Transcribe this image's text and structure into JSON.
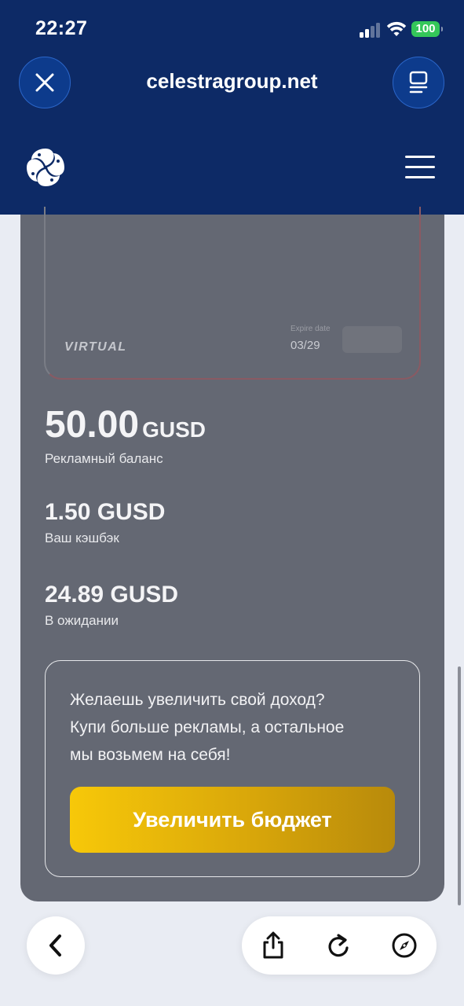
{
  "status_bar": {
    "time": "22:27",
    "battery": "100",
    "battery_color": "#34c759"
  },
  "browser": {
    "url": "celestragroup.net",
    "close_icon": "close-icon",
    "tabs_icon": "tabs-icon"
  },
  "site": {
    "logo": "celestra-logo",
    "menu_icon": "hamburger-menu-icon",
    "header_color": "#0d2a66"
  },
  "card": {
    "type_label": "VIRTUAL",
    "expire_label": "Expire date",
    "expire_value": "03/29"
  },
  "balances": {
    "ad_balance": {
      "amount": "50.00",
      "unit": "GUSD",
      "label": "Рекламный баланс"
    },
    "cashback": {
      "amount": "1.50 GUSD",
      "label": "Ваш кэшбэк"
    },
    "pending": {
      "amount": "24.89 GUSD",
      "label": "В ожидании"
    }
  },
  "promo": {
    "line1": "Желаешь увеличить свой доход?",
    "line2": "Купи больше рекламы, а остальное",
    "line3": "мы возьмем на себя!",
    "button_label": "Увеличить бюджет",
    "button_color": "#f7c809"
  },
  "bottom_bar": {
    "back_icon": "chevron-left-icon",
    "share_icon": "share-icon",
    "reload_icon": "reload-icon",
    "compass_icon": "compass-icon"
  }
}
